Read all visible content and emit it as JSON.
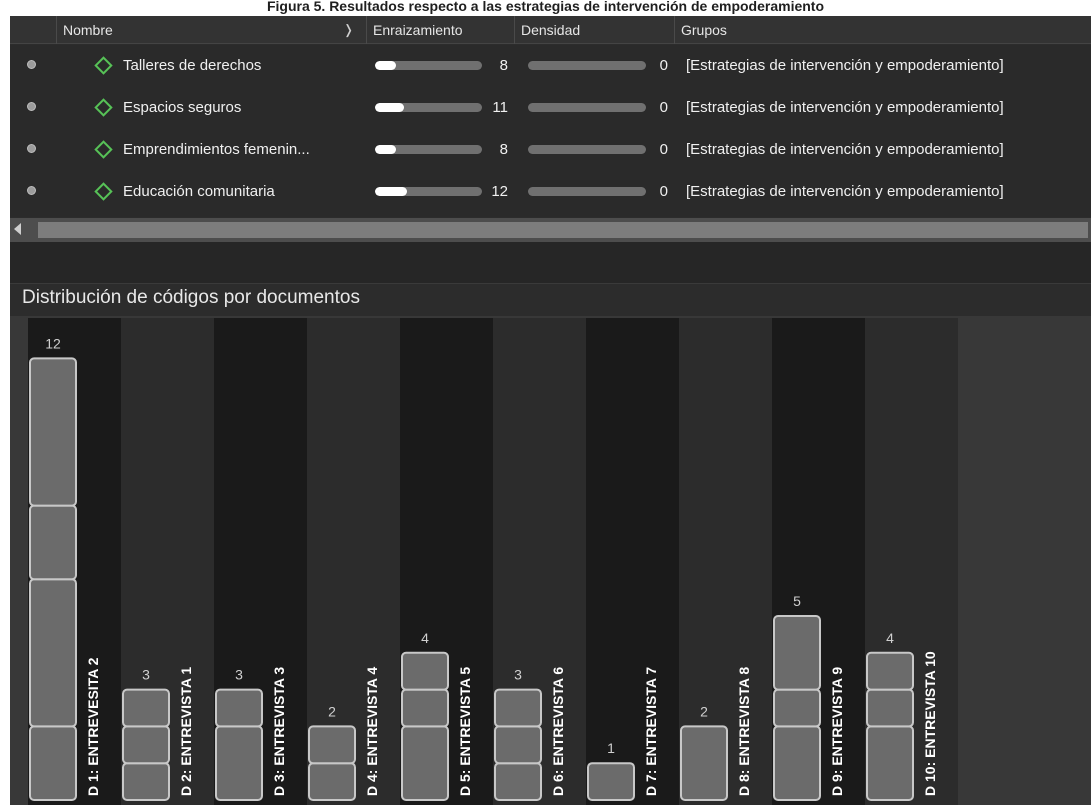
{
  "caption": "Figura 5. Resultados respecto a las estrategias de intervención de empoderamiento",
  "table": {
    "columns": {
      "name": "Nombre",
      "rooting": "Enraizamiento",
      "density": "Densidad",
      "groups": "Grupos"
    },
    "rows": [
      {
        "name": "Talleres de derechos",
        "rooting": 8,
        "density": 0,
        "groups": "[Estrategias de intervención y empoderamiento]"
      },
      {
        "name": "Espacios seguros",
        "rooting": 11,
        "density": 0,
        "groups": "[Estrategias de intervención y empoderamiento]"
      },
      {
        "name": "Emprendimientos femenin...",
        "rooting": 8,
        "density": 0,
        "groups": "[Estrategias de intervención y empoderamiento]"
      },
      {
        "name": "Educación comunitaria",
        "rooting": 12,
        "density": 0,
        "groups": "[Estrategias de intervención y empoderamiento]"
      }
    ],
    "rooting_bar_max": 40,
    "density_bar_max": 40
  },
  "chart_title": "Distribución de códigos por documentos",
  "chart_data": {
    "type": "bar",
    "stacked": true,
    "categories": [
      "D 1: ENTREVESITA 2",
      "D 2: ENTREVISTA 1",
      "D 3: ENTREVISTA 3",
      "D 4: ENTREVISTA 4",
      "D 5: ENTREVISTA 5",
      "D 6: ENTREVISTA 6",
      "D 7: ENTREVISTA 7",
      "D 8: ENTREVISTA 8",
      "D 9: ENTREVISTA 9",
      "D 10: ENTREVISTA 10"
    ],
    "values": [
      12,
      3,
      3,
      2,
      4,
      3,
      1,
      2,
      5,
      4
    ],
    "segments": [
      [
        2,
        4,
        2,
        4
      ],
      [
        1,
        1,
        1
      ],
      [
        2,
        1
      ],
      [
        1,
        1
      ],
      [
        2,
        1,
        1
      ],
      [
        1,
        1,
        1
      ],
      [
        1
      ],
      [
        2
      ],
      [
        2,
        1,
        2
      ],
      [
        2,
        1,
        1
      ]
    ],
    "ylim": [
      0,
      12
    ],
    "colors": {
      "bar": "#6b6b6b",
      "bar_border": "#c8c8c8",
      "label": "#d0d0d0",
      "column_dark": "#1a1a1a",
      "column_light": "#2c2c2c"
    }
  }
}
